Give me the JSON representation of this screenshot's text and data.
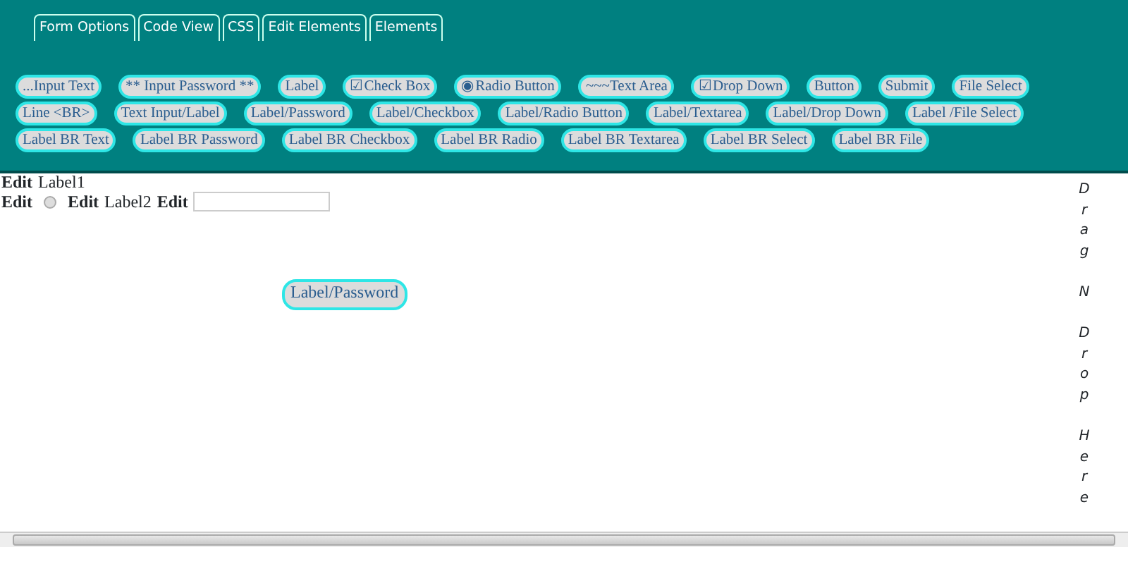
{
  "tabs": [
    "Form Options",
    "Code View",
    "CSS",
    "Edit Elements",
    "Elements"
  ],
  "toolbox_rows": [
    [
      "...Input Text",
      "** Input Password **",
      "Label",
      "☑Check Box",
      "◉Radio Button",
      "~~~Text Area",
      "☑Drop Down",
      "Button",
      "Submit",
      "File Select"
    ],
    [
      "Line <BR>",
      "Text Input/Label",
      "Label/Password",
      "Label/Checkbox",
      "Label/Radio Button",
      "Label/Textarea",
      "Label/Drop Down",
      "Label /File Select"
    ],
    [
      "Label BR Text",
      "Label BR Password",
      "Label BR Checkbox",
      "Label BR Radio",
      "Label BR Textarea",
      "Label BR Select",
      "Label BR File"
    ]
  ],
  "canvas": {
    "lines": [
      [
        {
          "kind": "edit",
          "text": "Edit"
        },
        {
          "kind": "text",
          "text": "Label1"
        }
      ],
      [
        {
          "kind": "edit",
          "text": "Edit"
        },
        {
          "kind": "radio",
          "checked": false
        },
        {
          "kind": "edit",
          "text": "Edit"
        },
        {
          "kind": "text",
          "text": "Label2"
        },
        {
          "kind": "edit",
          "text": "Edit"
        },
        {
          "kind": "input"
        }
      ]
    ],
    "dropped": [
      {
        "label": "Label/Password"
      }
    ],
    "drop_hint": "Drag N Drop Here"
  }
}
